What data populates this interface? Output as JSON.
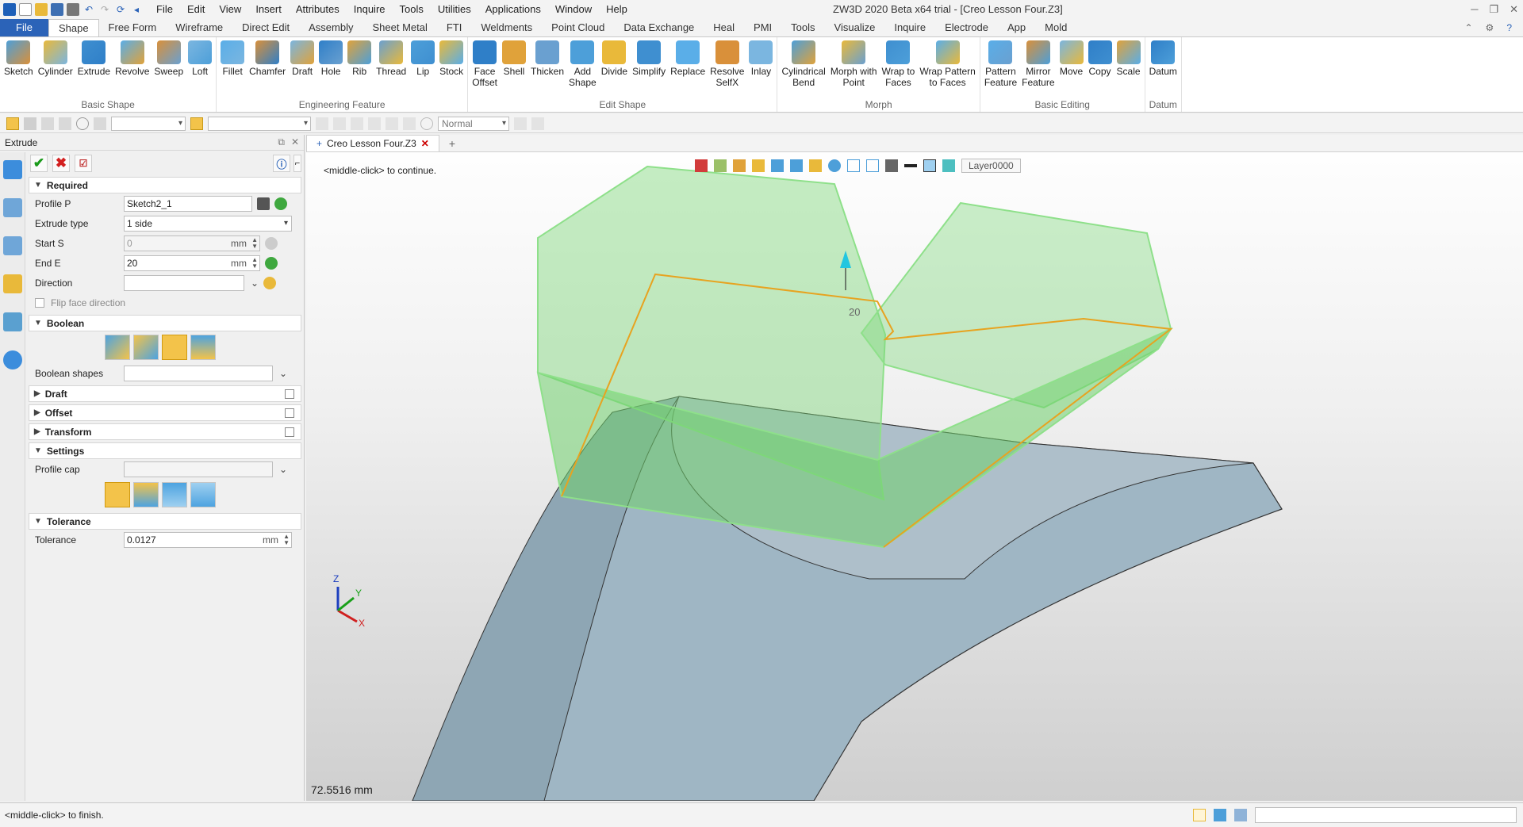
{
  "window": {
    "title": "ZW3D 2020 Beta x64 trial - [Creo Lesson Four.Z3]",
    "menu": [
      "File",
      "Edit",
      "View",
      "Insert",
      "Attributes",
      "Inquire",
      "Tools",
      "Utilities",
      "Applications",
      "Window",
      "Help"
    ]
  },
  "ribbon_tabs": [
    "File",
    "Shape",
    "Free Form",
    "Wireframe",
    "Direct Edit",
    "Assembly",
    "Sheet Metal",
    "FTI",
    "Weldments",
    "Point Cloud",
    "Data Exchange",
    "Heal",
    "PMI",
    "Tools",
    "Visualize",
    "Inquire",
    "Electrode",
    "App",
    "Mold"
  ],
  "ribbon_active": "Shape",
  "ribbon_groups": [
    {
      "label": "Basic Shape",
      "buttons": [
        "Sketch",
        "Cylinder",
        "Extrude",
        "Revolve",
        "Sweep",
        "Loft"
      ]
    },
    {
      "label": "Engineering Feature",
      "buttons": [
        "Fillet",
        "Chamfer",
        "Draft",
        "Hole",
        "Rib",
        "Thread",
        "Lip",
        "Stock"
      ]
    },
    {
      "label": "Edit Shape",
      "buttons": [
        "Face\nOffset",
        "Shell",
        "Thicken",
        "Add\nShape",
        "Divide",
        "Simplify",
        "Replace",
        "Resolve\nSelfX",
        "Inlay"
      ]
    },
    {
      "label": "Morph",
      "buttons": [
        "Cylindrical\nBend",
        "Morph with\nPoint",
        "Wrap to\nFaces",
        "Wrap Pattern\nto Faces"
      ]
    },
    {
      "label": "Basic Editing",
      "buttons": [
        "Pattern\nFeature",
        "Mirror\nFeature",
        "Move",
        "Copy",
        "Scale"
      ]
    },
    {
      "label": "Datum",
      "buttons": [
        "Datum"
      ]
    }
  ],
  "toolbar": {
    "render_mode": "Normal"
  },
  "panel": {
    "title": "Extrude",
    "sections": {
      "required": "Required",
      "boolean": "Boolean",
      "draft": "Draft",
      "offset": "Offset",
      "transform": "Transform",
      "settings": "Settings",
      "tolerance": "Tolerance"
    },
    "fields": {
      "profile_label": "Profile P",
      "profile_value": "Sketch2_1",
      "extrude_type_label": "Extrude type",
      "extrude_type_value": "1 side",
      "start_label": "Start S",
      "start_value": "0",
      "start_unit": "mm",
      "end_label": "End E",
      "end_value": "20",
      "end_unit": "mm",
      "direction_label": "Direction",
      "flip_label": "Flip face direction",
      "boolean_shapes_label": "Boolean shapes",
      "profile_cap_label": "Profile cap",
      "tolerance_label": "Tolerance",
      "tolerance_value": "0.0127",
      "tolerance_unit": "mm"
    }
  },
  "viewport": {
    "document_tab": "Creo Lesson Four.Z3",
    "prompt": "<middle-click> to continue.",
    "layer": "Layer0000",
    "measurement": "72.5516 mm",
    "dimension_label": "20",
    "axis_labels": {
      "x": "X",
      "y": "Y",
      "z": "Z"
    }
  },
  "status": {
    "message": "<middle-click> to finish."
  },
  "colors": {
    "accent": "#2b63b8",
    "highlight": "#f3c34a",
    "preview_green": "#7ed67a",
    "solid_blue": "#9fb6c4"
  }
}
